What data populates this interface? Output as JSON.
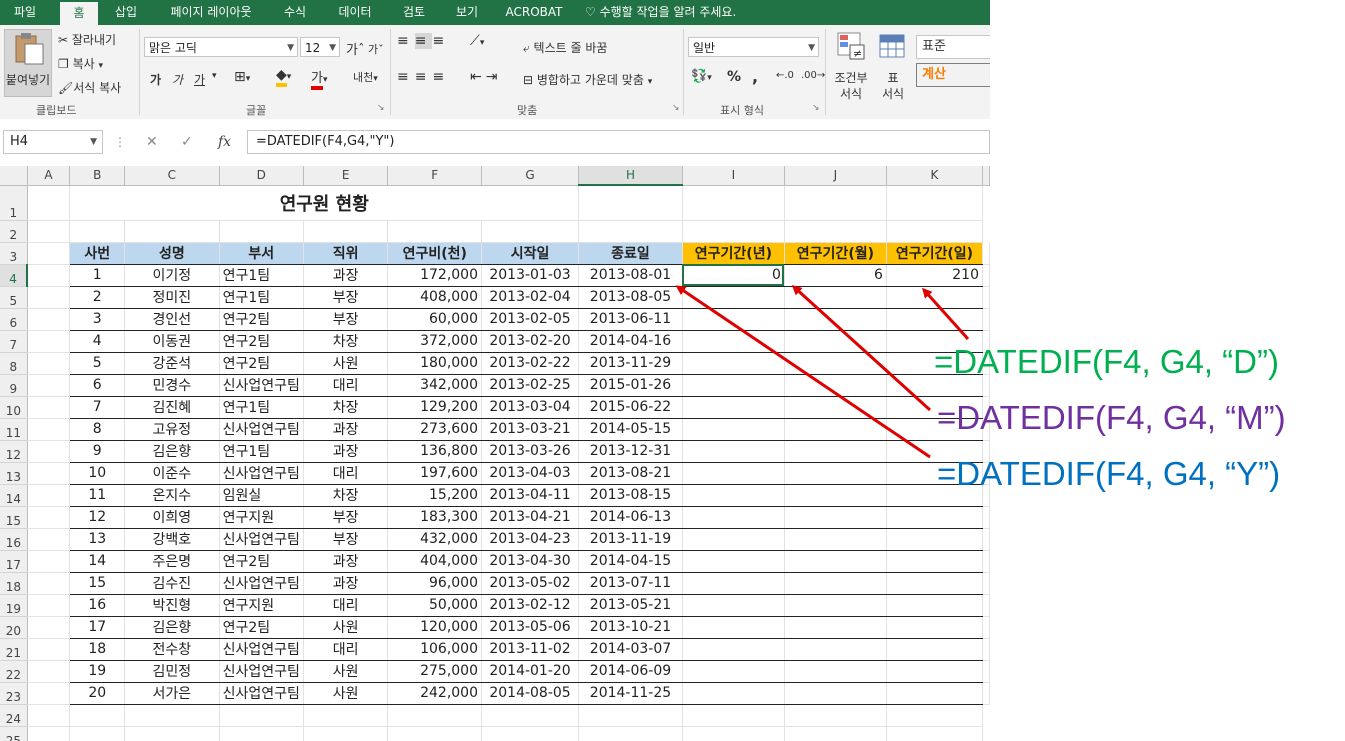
{
  "menu": {
    "tabs": [
      "파일",
      "홈",
      "삽입",
      "페이지 레이아웃",
      "수식",
      "데이터",
      "검토",
      "보기",
      "ACROBAT"
    ],
    "tell_me": "수행할 작업을 알려 주세요."
  },
  "ribbon": {
    "clipboard": {
      "paste": "붙여넣기",
      "cut": "잘라내기",
      "copy": "복사",
      "format_painter": "서식 복사",
      "label": "클립보드"
    },
    "font": {
      "name": "맑은 고딕",
      "size": "12",
      "bold": "가",
      "italic": "가",
      "underline": "가",
      "label": "글꼴",
      "phonetic": "내천"
    },
    "alignment": {
      "wrap": "텍스트 줄 바꿈",
      "merge": "병합하고 가운데 맞춤",
      "label": "맞춤"
    },
    "number": {
      "format": "일반",
      "percent": "%",
      "comma": ",",
      "label": "표시 형식"
    },
    "styles": {
      "conditional_1": "조건부",
      "conditional_2": "서식",
      "table_1": "표",
      "table_2": "서식",
      "normal": "표준",
      "calc": "계산"
    }
  },
  "formula_bar": {
    "name_box": "H4",
    "formula": "=DATEDIF(F4,G4,\"Y\")",
    "cancel": "✕",
    "enter": "✓",
    "fx": "fx"
  },
  "sheet": {
    "columns": [
      "A",
      "B",
      "C",
      "D",
      "E",
      "F",
      "G",
      "H",
      "I",
      "J",
      "K"
    ],
    "title": "연구원 현황",
    "headers": [
      "사번",
      "성명",
      "부서",
      "직위",
      "연구비(천)",
      "시작일",
      "종료일",
      "연구기간(년)",
      "연구기간(월)",
      "연구기간(일)"
    ],
    "rows": [
      [
        "1",
        "이기정",
        "연구1팀",
        "과장",
        "172,000",
        "2013-01-03",
        "2013-08-01",
        "0",
        "6",
        "210"
      ],
      [
        "2",
        "정미진",
        "연구1팀",
        "부장",
        "408,000",
        "2013-02-04",
        "2013-08-05",
        "",
        "",
        ""
      ],
      [
        "3",
        "경인선",
        "연구2팀",
        "부장",
        "60,000",
        "2013-02-05",
        "2013-06-11",
        "",
        "",
        ""
      ],
      [
        "4",
        "이동권",
        "연구2팀",
        "차장",
        "372,000",
        "2013-02-20",
        "2014-04-16",
        "",
        "",
        ""
      ],
      [
        "5",
        "강준석",
        "연구2팀",
        "사원",
        "180,000",
        "2013-02-22",
        "2013-11-29",
        "",
        "",
        ""
      ],
      [
        "6",
        "민경수",
        "신사업연구팀",
        "대리",
        "342,000",
        "2013-02-25",
        "2015-01-26",
        "",
        "",
        ""
      ],
      [
        "7",
        "김진혜",
        "연구1팀",
        "차장",
        "129,200",
        "2013-03-04",
        "2015-06-22",
        "",
        "",
        ""
      ],
      [
        "8",
        "고유정",
        "신사업연구팀",
        "과장",
        "273,600",
        "2013-03-21",
        "2014-05-15",
        "",
        "",
        ""
      ],
      [
        "9",
        "김은향",
        "연구1팀",
        "과장",
        "136,800",
        "2013-03-26",
        "2013-12-31",
        "",
        "",
        ""
      ],
      [
        "10",
        "이준수",
        "신사업연구팀",
        "대리",
        "197,600",
        "2013-04-03",
        "2013-08-21",
        "",
        "",
        ""
      ],
      [
        "11",
        "온지수",
        "임원실",
        "차장",
        "15,200",
        "2013-04-11",
        "2013-08-15",
        "",
        "",
        ""
      ],
      [
        "12",
        "이희영",
        "연구지원",
        "부장",
        "183,300",
        "2013-04-21",
        "2014-06-13",
        "",
        "",
        ""
      ],
      [
        "13",
        "강백호",
        "신사업연구팀",
        "부장",
        "432,000",
        "2013-04-23",
        "2013-11-19",
        "",
        "",
        ""
      ],
      [
        "14",
        "주은명",
        "연구2팀",
        "과장",
        "404,000",
        "2013-04-30",
        "2014-04-15",
        "",
        "",
        ""
      ],
      [
        "15",
        "김수진",
        "신사업연구팀",
        "과장",
        "96,000",
        "2013-05-02",
        "2013-07-11",
        "",
        "",
        ""
      ],
      [
        "16",
        "박진형",
        "연구지원",
        "대리",
        "50,000",
        "2013-02-12",
        "2013-05-21",
        "",
        "",
        ""
      ],
      [
        "17",
        "김은향",
        "연구2팀",
        "사원",
        "120,000",
        "2013-05-06",
        "2013-10-21",
        "",
        "",
        ""
      ],
      [
        "18",
        "전수창",
        "신사업연구팀",
        "대리",
        "106,000",
        "2013-11-02",
        "2014-03-07",
        "",
        "",
        ""
      ],
      [
        "19",
        "김민정",
        "신사업연구팀",
        "사원",
        "275,000",
        "2014-01-20",
        "2014-06-09",
        "",
        "",
        ""
      ],
      [
        "20",
        "서가은",
        "신사업연구팀",
        "사원",
        "242,000",
        "2014-08-05",
        "2014-11-25",
        "",
        "",
        ""
      ]
    ]
  },
  "annotations": {
    "d": {
      "text": "=DATEDIF(F4, G4, “D”)",
      "color": "#00b050"
    },
    "m": {
      "text": "=DATEDIF(F4, G4, “M”)",
      "color": "#7030a0"
    },
    "y": {
      "text": "=DATEDIF(F4, G4, “Y”)",
      "color": "#0070c0"
    },
    "arrow_color": "#e00000"
  }
}
